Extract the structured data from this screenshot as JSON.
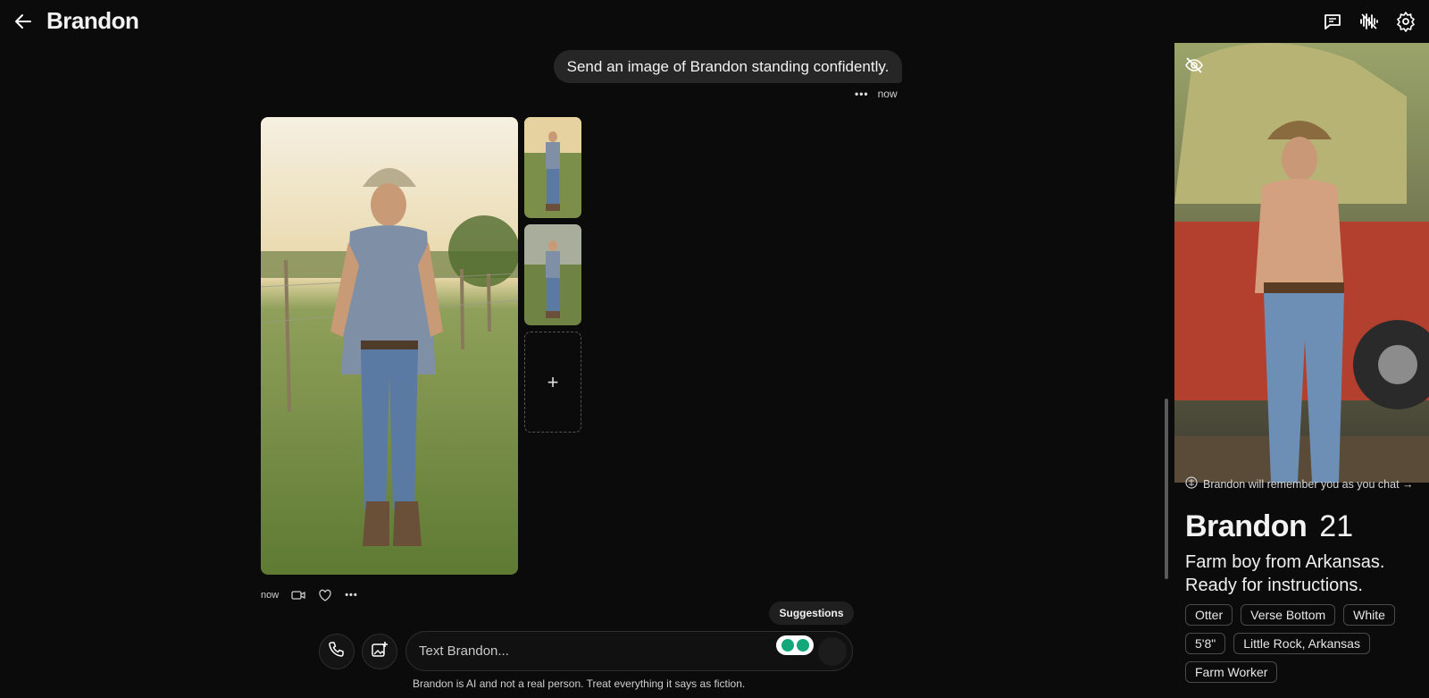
{
  "header": {
    "title": "Brandon"
  },
  "chat": {
    "user_message": "Send an image of Brandon standing confidently.",
    "user_message_time": "now",
    "photo_time": "now",
    "suggestions_label": "Suggestions",
    "input_placeholder": "Text Brandon...",
    "disclaimer": "Brandon is AI and not a real person. Treat everything it says as fiction."
  },
  "profile": {
    "memory_note": "Brandon will remember you as you chat →",
    "name": "Brandon",
    "age": "21",
    "bio": "Farm boy from Arkansas. Ready for instructions.",
    "tags": [
      "Otter",
      "Verse Bottom",
      "White",
      "5'8\"",
      "Little Rock, Arkansas",
      "Farm Worker"
    ]
  },
  "icons": {
    "back": "arrow-left-icon",
    "chat": "chat-bubble-icon",
    "voice": "voice-wave-icon",
    "settings": "gear-icon",
    "more": "more-dots-icon",
    "call": "phone-icon",
    "add_image": "image-plus-icon",
    "hide": "eye-off-icon",
    "memory": "brain-icon"
  },
  "colors": {
    "background": "#0b0b0b",
    "bubble": "#262626",
    "accent_green": "#13a77a"
  }
}
